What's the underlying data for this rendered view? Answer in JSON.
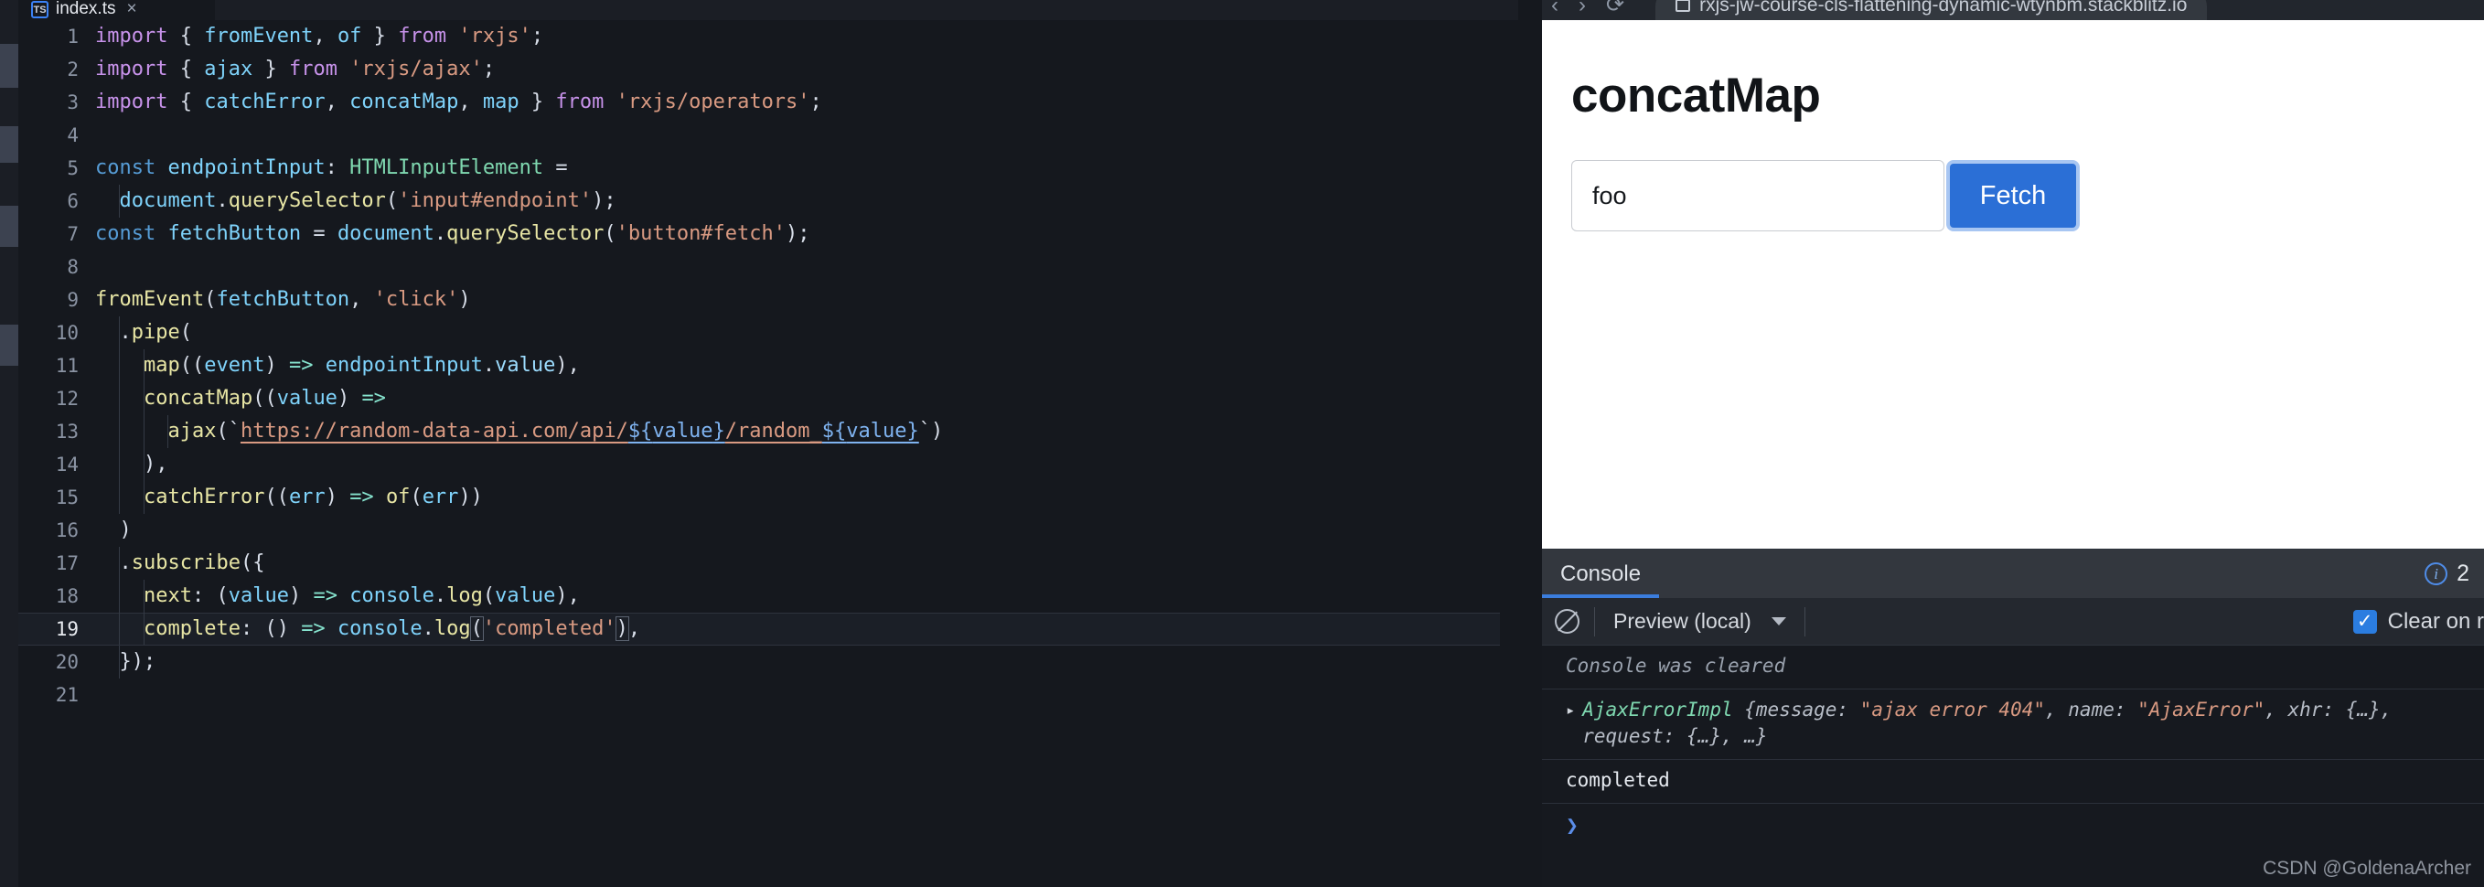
{
  "editor": {
    "tab": {
      "label": "index.ts",
      "icon": "typescript-file-icon",
      "badge": "TS",
      "close": "×"
    },
    "active_line": 19,
    "lines": [
      {
        "n": "1",
        "segments": [
          {
            "t": "import ",
            "c": "kw"
          },
          {
            "t": "{ ",
            "c": "punc"
          },
          {
            "t": "fromEvent",
            "c": "var"
          },
          {
            "t": ", ",
            "c": "punc"
          },
          {
            "t": "of",
            "c": "var"
          },
          {
            "t": " } ",
            "c": "punc"
          },
          {
            "t": "from ",
            "c": "kw"
          },
          {
            "t": "'rxjs'",
            "c": "str"
          },
          {
            "t": ";",
            "c": "punc"
          }
        ]
      },
      {
        "n": "2",
        "segments": [
          {
            "t": "import ",
            "c": "kw"
          },
          {
            "t": "{ ",
            "c": "punc"
          },
          {
            "t": "ajax",
            "c": "var"
          },
          {
            "t": " } ",
            "c": "punc"
          },
          {
            "t": "from ",
            "c": "kw"
          },
          {
            "t": "'rxjs/ajax'",
            "c": "str"
          },
          {
            "t": ";",
            "c": "punc"
          }
        ]
      },
      {
        "n": "3",
        "segments": [
          {
            "t": "import ",
            "c": "kw"
          },
          {
            "t": "{ ",
            "c": "punc"
          },
          {
            "t": "catchError",
            "c": "var"
          },
          {
            "t": ", ",
            "c": "punc"
          },
          {
            "t": "concatMap",
            "c": "var"
          },
          {
            "t": ", ",
            "c": "punc"
          },
          {
            "t": "map",
            "c": "var"
          },
          {
            "t": " } ",
            "c": "punc"
          },
          {
            "t": "from ",
            "c": "kw"
          },
          {
            "t": "'rxjs/operators'",
            "c": "str"
          },
          {
            "t": ";",
            "c": "punc"
          }
        ]
      },
      {
        "n": "4",
        "segments": []
      },
      {
        "n": "5",
        "segments": [
          {
            "t": "const ",
            "c": "const"
          },
          {
            "t": "endpointInput",
            "c": "var"
          },
          {
            "t": ": ",
            "c": "punc"
          },
          {
            "t": "HTMLInputElement",
            "c": "type"
          },
          {
            "t": " =",
            "c": "punc"
          }
        ]
      },
      {
        "n": "6",
        "segments": [
          {
            "t": "  ",
            "c": "punc"
          },
          {
            "t": "document",
            "c": "var"
          },
          {
            "t": ".",
            "c": "punc"
          },
          {
            "t": "querySelector",
            "c": "fn"
          },
          {
            "t": "(",
            "c": "punc"
          },
          {
            "t": "'input#endpoint'",
            "c": "str"
          },
          {
            "t": ");",
            "c": "punc"
          }
        ]
      },
      {
        "n": "7",
        "segments": [
          {
            "t": "const ",
            "c": "const"
          },
          {
            "t": "fetchButton",
            "c": "var"
          },
          {
            "t": " = ",
            "c": "punc"
          },
          {
            "t": "document",
            "c": "var"
          },
          {
            "t": ".",
            "c": "punc"
          },
          {
            "t": "querySelector",
            "c": "fn"
          },
          {
            "t": "(",
            "c": "punc"
          },
          {
            "t": "'button#fetch'",
            "c": "str"
          },
          {
            "t": ");",
            "c": "punc"
          }
        ]
      },
      {
        "n": "8",
        "segments": []
      },
      {
        "n": "9",
        "segments": [
          {
            "t": "fromEvent",
            "c": "fn"
          },
          {
            "t": "(",
            "c": "punc"
          },
          {
            "t": "fetchButton",
            "c": "var"
          },
          {
            "t": ", ",
            "c": "punc"
          },
          {
            "t": "'click'",
            "c": "str"
          },
          {
            "t": ")",
            "c": "punc"
          }
        ]
      },
      {
        "n": "10",
        "segments": [
          {
            "t": "  .",
            "c": "punc"
          },
          {
            "t": "pipe",
            "c": "fn"
          },
          {
            "t": "(",
            "c": "punc"
          }
        ]
      },
      {
        "n": "11",
        "segments": [
          {
            "t": "    ",
            "c": "punc"
          },
          {
            "t": "map",
            "c": "fn"
          },
          {
            "t": "((",
            "c": "punc"
          },
          {
            "t": "event",
            "c": "var"
          },
          {
            "t": ") ",
            "c": "punc"
          },
          {
            "t": "=>",
            "c": "op"
          },
          {
            "t": " ",
            "c": "punc"
          },
          {
            "t": "endpointInput",
            "c": "var"
          },
          {
            "t": ".",
            "c": "punc"
          },
          {
            "t": "value",
            "c": "mem"
          },
          {
            "t": "),",
            "c": "punc"
          }
        ]
      },
      {
        "n": "12",
        "segments": [
          {
            "t": "    ",
            "c": "punc"
          },
          {
            "t": "concatMap",
            "c": "fn"
          },
          {
            "t": "((",
            "c": "punc"
          },
          {
            "t": "value",
            "c": "var"
          },
          {
            "t": ") ",
            "c": "punc"
          },
          {
            "t": "=>",
            "c": "op"
          }
        ]
      },
      {
        "n": "13",
        "segments": [
          {
            "t": "      ",
            "c": "punc"
          },
          {
            "t": "ajax",
            "c": "fn"
          },
          {
            "t": "(`",
            "c": "punc"
          },
          {
            "t": "https://random-data-api.com/api/",
            "c": "url"
          },
          {
            "t": "${",
            "c": "urlv"
          },
          {
            "t": "value",
            "c": "urlv"
          },
          {
            "t": "}",
            "c": "urlv"
          },
          {
            "t": "/random_",
            "c": "url"
          },
          {
            "t": "${",
            "c": "urlv"
          },
          {
            "t": "value",
            "c": "urlv"
          },
          {
            "t": "}",
            "c": "urlv"
          },
          {
            "t": "`)",
            "c": "punc"
          }
        ]
      },
      {
        "n": "14",
        "segments": [
          {
            "t": "    ),",
            "c": "punc"
          }
        ]
      },
      {
        "n": "15",
        "segments": [
          {
            "t": "    ",
            "c": "punc"
          },
          {
            "t": "catchError",
            "c": "fn"
          },
          {
            "t": "((",
            "c": "punc"
          },
          {
            "t": "err",
            "c": "var"
          },
          {
            "t": ") ",
            "c": "punc"
          },
          {
            "t": "=>",
            "c": "op"
          },
          {
            "t": " ",
            "c": "punc"
          },
          {
            "t": "of",
            "c": "fn"
          },
          {
            "t": "(",
            "c": "punc"
          },
          {
            "t": "err",
            "c": "var"
          },
          {
            "t": "))",
            "c": "punc"
          }
        ]
      },
      {
        "n": "16",
        "segments": [
          {
            "t": "  )",
            "c": "punc"
          }
        ]
      },
      {
        "n": "17",
        "segments": [
          {
            "t": "  .",
            "c": "punc"
          },
          {
            "t": "subscribe",
            "c": "fn"
          },
          {
            "t": "({",
            "c": "punc"
          }
        ]
      },
      {
        "n": "18",
        "segments": [
          {
            "t": "    ",
            "c": "punc"
          },
          {
            "t": "next",
            "c": "fn"
          },
          {
            "t": ": (",
            "c": "punc"
          },
          {
            "t": "value",
            "c": "var"
          },
          {
            "t": ") ",
            "c": "punc"
          },
          {
            "t": "=>",
            "c": "op"
          },
          {
            "t": " ",
            "c": "punc"
          },
          {
            "t": "console",
            "c": "var"
          },
          {
            "t": ".",
            "c": "punc"
          },
          {
            "t": "log",
            "c": "fn"
          },
          {
            "t": "(",
            "c": "punc"
          },
          {
            "t": "value",
            "c": "var"
          },
          {
            "t": "),",
            "c": "punc"
          }
        ]
      },
      {
        "n": "19",
        "segments": [
          {
            "t": "    ",
            "c": "punc"
          },
          {
            "t": "complete",
            "c": "fn"
          },
          {
            "t": ": () ",
            "c": "punc"
          },
          {
            "t": "=>",
            "c": "op"
          },
          {
            "t": " ",
            "c": "punc"
          },
          {
            "t": "console",
            "c": "var"
          },
          {
            "t": ".",
            "c": "punc"
          },
          {
            "t": "log",
            "c": "fn"
          },
          {
            "t": "(",
            "c": "brkt"
          },
          {
            "t": "'completed'",
            "c": "str"
          },
          {
            "t": ")",
            "c": "brkt"
          },
          {
            "t": ",",
            "c": "punc"
          }
        ]
      },
      {
        "n": "20",
        "segments": [
          {
            "t": "  });",
            "c": "punc"
          }
        ]
      },
      {
        "n": "21",
        "segments": []
      }
    ]
  },
  "browser": {
    "back_icon": "back-arrow-icon",
    "forward_icon": "forward-arrow-icon",
    "reload_icon": "reload-icon",
    "url": "rxjs-jw-course-cls-flattening-dynamic-wtynbm.stackblitz.io"
  },
  "preview": {
    "title": "concatMap",
    "input_value": "foo",
    "input_placeholder": "",
    "fetch_label": "Fetch"
  },
  "console": {
    "tab_label": "Console",
    "badge_count": "2",
    "info_icon": "info-icon",
    "clear_icon": "clear-console-icon",
    "context_label": "Preview (local)",
    "clear_on_reload_label": "Clear on r",
    "clear_on_reload_checked": true,
    "checkmark": "✓",
    "rows": {
      "cleared": "Console was cleared",
      "error": {
        "disclosure": "▸",
        "class_name": "AjaxErrorImpl",
        "line1_pre": " {message: ",
        "line1_v1": "\"ajax error 404\"",
        "line1_mid": ", name: ",
        "line1_v2": "\"AjaxError\"",
        "line1_post": ", xhr: {…},",
        "line2": "request: {…}, …}"
      },
      "completed": "completed",
      "prompt": "❯"
    }
  },
  "watermark": "CSDN @GoldenaArcher",
  "colors": {
    "accent_blue": "#2b6fd6",
    "editor_bg": "#15181e",
    "console_bg": "#16191f",
    "tabbar_bg": "#33373e"
  }
}
